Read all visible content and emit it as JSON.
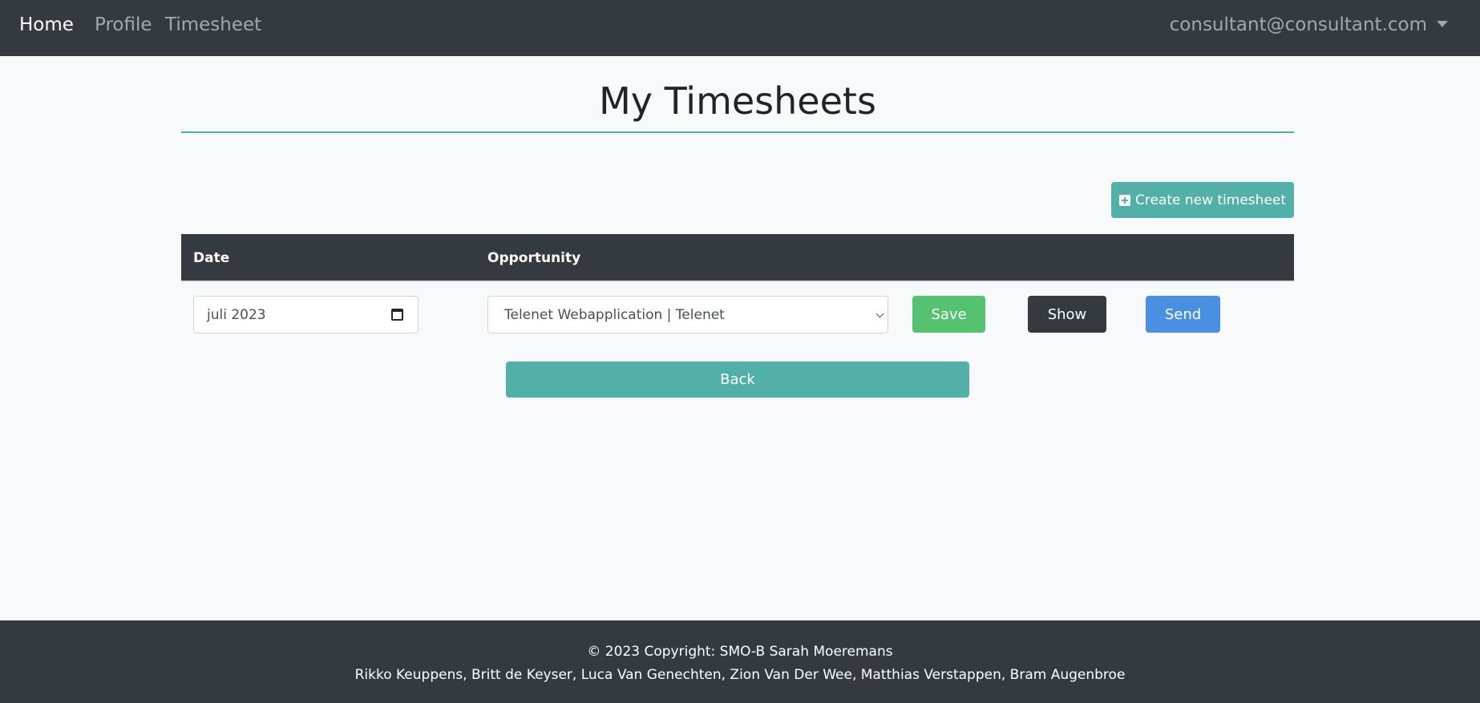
{
  "nav": {
    "home": "Home",
    "profile": "Profile",
    "timesheet": "Timesheet",
    "user": "consultant@consultant.com"
  },
  "page": {
    "title": "My Timesheets"
  },
  "actions": {
    "create": "Create new timesheet",
    "back": "Back"
  },
  "table": {
    "headers": [
      "Date",
      "Opportunity"
    ],
    "row": {
      "date": "juli 2023",
      "opportunity": "Telenet Webapplication | Telenet",
      "save": "Save",
      "show": "Show",
      "send": "Send"
    }
  },
  "footer": {
    "copyright": "© 2023 Copyright: SMO-B Sarah Moeremans",
    "authors": "Rikko Keuppens, Britt de Keyser, Luca Van Genechten, Zion Van Der Wee, Matthias Verstappen, Bram Augenbroe"
  },
  "colors": {
    "navbar": "#343a40",
    "accent": "#52b0a8",
    "save": "#54c271",
    "send": "#4a90e2",
    "background": "#f8f9fa"
  }
}
